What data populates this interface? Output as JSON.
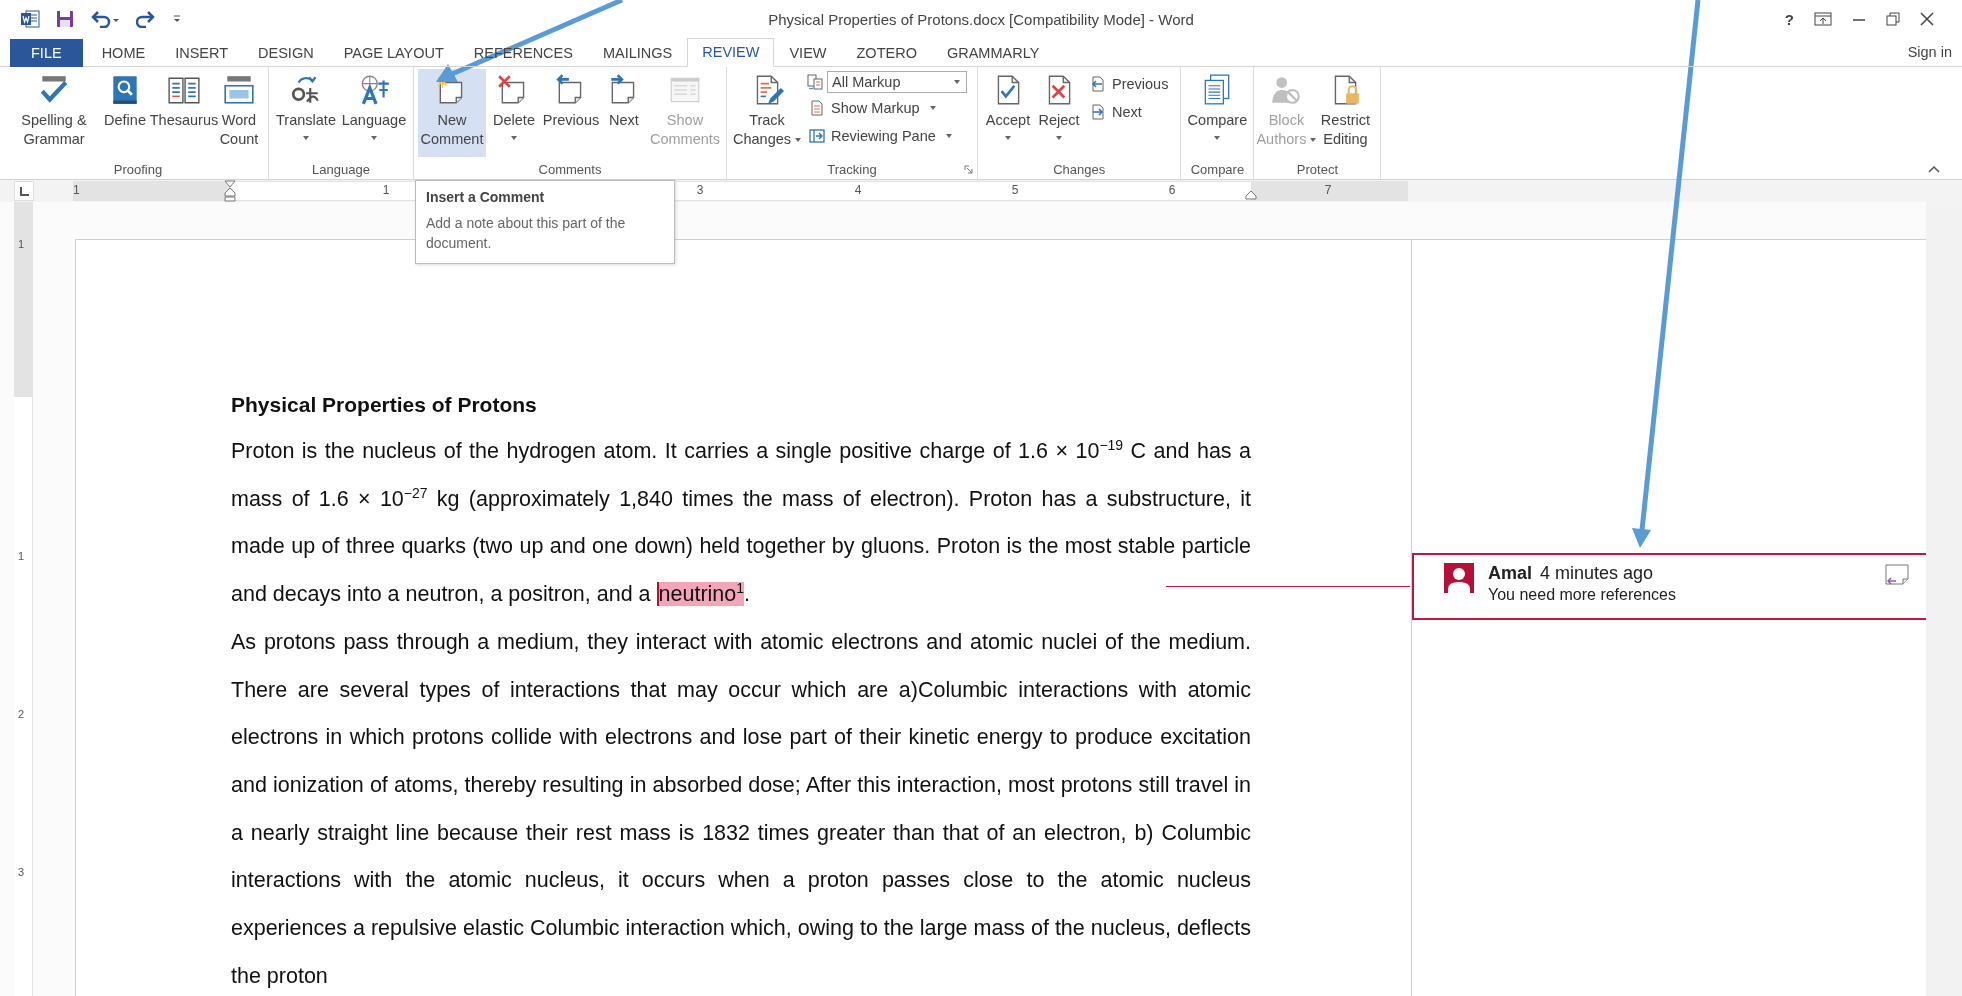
{
  "window": {
    "title": "Physical Properties of Protons.docx [Compatibility Mode] - Word",
    "help": "?",
    "sign_in": "Sign in"
  },
  "tabs": [
    {
      "label": "FILE",
      "kind": "file",
      "selected": false
    },
    {
      "label": "HOME",
      "kind": "tab",
      "selected": false
    },
    {
      "label": "INSERT",
      "kind": "tab",
      "selected": false
    },
    {
      "label": "DESIGN",
      "kind": "tab",
      "selected": false
    },
    {
      "label": "PAGE LAYOUT",
      "kind": "tab",
      "selected": false
    },
    {
      "label": "REFERENCES",
      "kind": "tab",
      "selected": false
    },
    {
      "label": "MAILINGS",
      "kind": "tab",
      "selected": false
    },
    {
      "label": "REVIEW",
      "kind": "tab",
      "selected": true
    },
    {
      "label": "VIEW",
      "kind": "tab",
      "selected": false
    },
    {
      "label": "ZOTERO",
      "kind": "tab",
      "selected": false
    },
    {
      "label": "GRAMMARLY",
      "kind": "tab",
      "selected": false
    }
  ],
  "ribbon": {
    "groups": [
      {
        "label": "Proofing",
        "items": [
          {
            "kind": "large",
            "lines": [
              "Spelling &",
              "Grammar"
            ],
            "dropdown": false,
            "disabled": false,
            "selected": false
          },
          {
            "kind": "large",
            "lines": [
              "Define"
            ],
            "dropdown": false,
            "disabled": false,
            "selected": false
          },
          {
            "kind": "large",
            "lines": [
              "Thesaurus"
            ],
            "dropdown": false,
            "disabled": false,
            "selected": false
          },
          {
            "kind": "large",
            "lines": [
              "Word",
              "Count"
            ],
            "dropdown": false,
            "disabled": false,
            "selected": false
          }
        ]
      },
      {
        "label": "Language",
        "items": [
          {
            "kind": "large",
            "lines": [
              "Translate"
            ],
            "dropdown": true,
            "disabled": false,
            "selected": false
          },
          {
            "kind": "large",
            "lines": [
              "Language"
            ],
            "dropdown": true,
            "disabled": false,
            "selected": false
          }
        ]
      },
      {
        "label": "Comments",
        "items": [
          {
            "kind": "large",
            "lines": [
              "New",
              "Comment"
            ],
            "dropdown": false,
            "disabled": false,
            "selected": true
          },
          {
            "kind": "large",
            "lines": [
              "Delete"
            ],
            "dropdown": true,
            "disabled": false,
            "selected": false
          },
          {
            "kind": "large",
            "lines": [
              "Previous"
            ],
            "dropdown": false,
            "disabled": false,
            "selected": false
          },
          {
            "kind": "large",
            "lines": [
              "Next"
            ],
            "dropdown": false,
            "disabled": false,
            "selected": false
          },
          {
            "kind": "large",
            "lines": [
              "Show",
              "Comments"
            ],
            "dropdown": false,
            "disabled": true,
            "selected": false
          }
        ]
      },
      {
        "label": "Tracking",
        "launcher": true,
        "items": [
          {
            "kind": "large",
            "lines": [
              "Track",
              "Changes"
            ],
            "dropdown": true,
            "disabled": false,
            "selected": false
          },
          {
            "kind": "select",
            "value": "All Markup"
          },
          {
            "kind": "small",
            "label": "Show Markup",
            "dropdown": true,
            "disabled": false
          },
          {
            "kind": "small",
            "label": "Reviewing Pane",
            "dropdown": true,
            "disabled": false
          }
        ]
      },
      {
        "label": "Changes",
        "items": [
          {
            "kind": "large",
            "lines": [
              "Accept"
            ],
            "dropdown": true,
            "disabled": false,
            "selected": false
          },
          {
            "kind": "large",
            "lines": [
              "Reject"
            ],
            "dropdown": true,
            "disabled": false,
            "selected": false
          },
          {
            "kind": "small",
            "label": "Previous",
            "dropdown": false,
            "disabled": false
          },
          {
            "kind": "small",
            "label": "Next",
            "dropdown": false,
            "disabled": false
          }
        ]
      },
      {
        "label": "Compare",
        "items": [
          {
            "kind": "large",
            "lines": [
              "Compare"
            ],
            "dropdown": true,
            "disabled": false,
            "selected": false
          }
        ]
      },
      {
        "label": "Protect",
        "items": [
          {
            "kind": "large",
            "lines": [
              "Block",
              "Authors"
            ],
            "dropdown": true,
            "disabled": true,
            "selected": false
          },
          {
            "kind": "large",
            "lines": [
              "Restrict",
              "Editing"
            ],
            "dropdown": false,
            "disabled": false,
            "selected": false
          }
        ]
      }
    ]
  },
  "tooltip": {
    "title": "Insert a Comment",
    "text": "Add a note about this part of the document."
  },
  "ruler": {
    "labels": [
      "1",
      "1",
      "3",
      "4",
      "5",
      "6",
      "7"
    ]
  },
  "vertical_ruler": {
    "labels": [
      "1",
      "1",
      "2",
      "3"
    ]
  },
  "document": {
    "heading": "Physical Properties of Protons",
    "paragraphs": [
      {
        "text": "Proton is the nucleus of the hydrogen atom. It carries a single positive charge of 1.6 × 10$^{−19}$ C and has a mass of 1.6 × 10$^{−27}$ kg (approximately 1,840 times the mass of electron). Proton has a substructure, it made up of three quarks (two up and one down) held together by gluons. Proton is the most stable particle and decays into a neutron, a positron, and a ",
        "anchor": "neutrino$^{1}$",
        "after": "."
      },
      {
        "text": "As protons pass through a medium, they interact with atomic electrons and atomic nuclei of the medium. There are several types of interactions that may occur which are a)Columbic interactions with atomic electrons in which protons collide with electrons and lose part of their kinetic energy to produce excitation and ionization of atoms, thereby resulting in absorbed dose; After this interaction, most protons still travel in a nearly straight line because their rest mass is 1832 times greater than that of an electron, b) Columbic interactions with the atomic nucleus, it occurs when a proton passes close to the atomic nucleus experiences a repulsive elastic Columbic interaction which, owing to the large mass of the nucleus, deflects the proton"
      }
    ]
  },
  "comment": {
    "author": "Amal",
    "time": "4 minutes ago",
    "text": "You need more references"
  }
}
